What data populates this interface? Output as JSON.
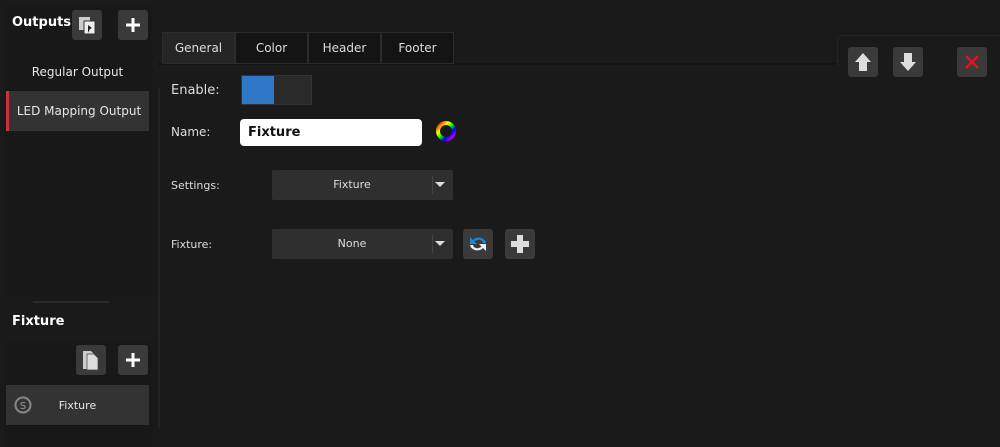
{
  "outputs": {
    "title": "Outputs",
    "items": [
      {
        "label": "Regular Output"
      },
      {
        "label": "LED Mapping Output",
        "selected": true
      }
    ]
  },
  "fixture_panel": {
    "title": "Fixture",
    "items": [
      {
        "label": "Fixture"
      }
    ]
  },
  "tabs": [
    {
      "label": "General",
      "active": true
    },
    {
      "label": "Color"
    },
    {
      "label": "Header"
    },
    {
      "label": "Footer"
    }
  ],
  "form": {
    "enable_label": "Enable:",
    "enable_value": true,
    "name_label": "Name:",
    "name_value": "Fixture",
    "settings_label": "Settings:",
    "settings_value": "Fixture",
    "fixture_label": "Fixture:",
    "fixture_value": "None"
  },
  "colors": {
    "accent": "#2f78c8",
    "selection": "#c8323c",
    "close": "#e0141e"
  }
}
